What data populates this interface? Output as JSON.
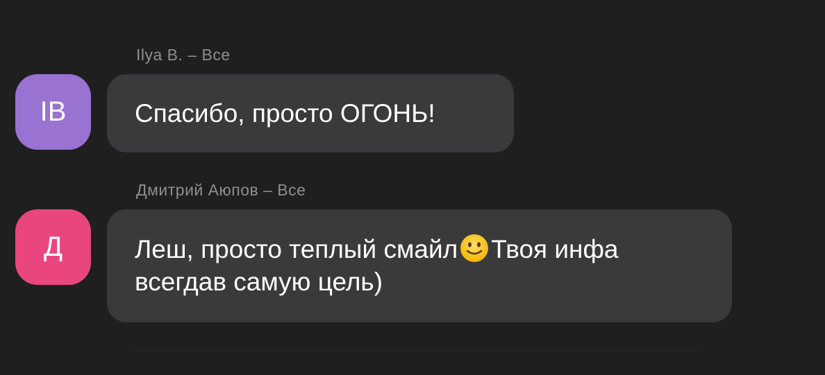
{
  "messages": [
    {
      "meta": "Ilya B. – Все",
      "avatar_initials": "IB",
      "avatar_color": "#9a72d2",
      "text": "Спасибо, просто ОГОНЬ!"
    },
    {
      "meta": "Дмитрий Аюпов – Все",
      "avatar_initials": "Д",
      "avatar_color": "#e9467f",
      "text_line1_before": "Леш, просто теплый смайл",
      "emoji_icon": "slightly-smiling-face-icon",
      "text_line1_after": "Твоя инфа",
      "text_line2": "всегдав самую цель)"
    }
  ],
  "colors": {
    "background": "#1f1f1f",
    "bubble": "#3a3a3c",
    "meta_text": "#8e8e93",
    "message_text": "#ffffff"
  }
}
